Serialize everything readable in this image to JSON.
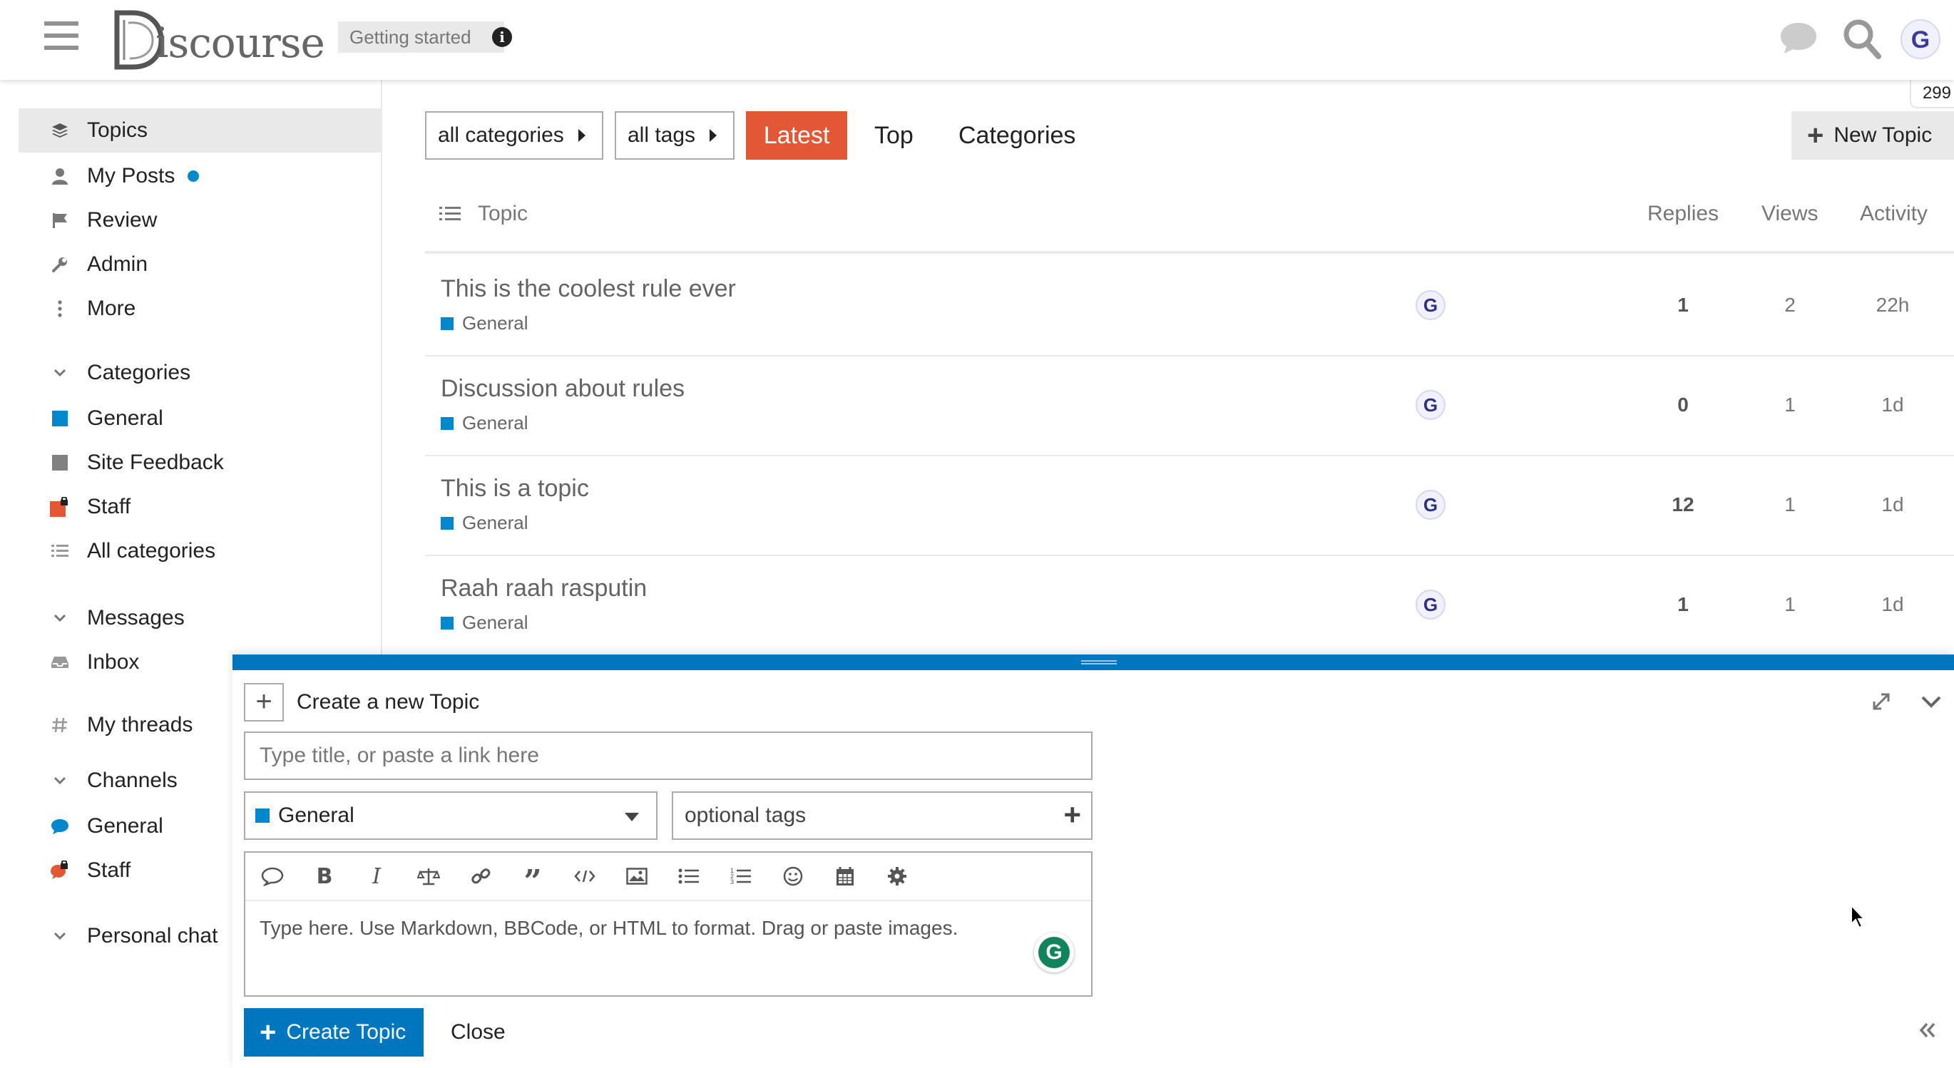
{
  "header": {
    "logo_text": "iscourse",
    "getting_started": "Getting started",
    "avatar_letter": "G",
    "notification_count": "299"
  },
  "sidebar": {
    "nav": [
      {
        "label": "Topics",
        "icon": "layers-icon"
      },
      {
        "label": "My Posts",
        "icon": "user-icon"
      },
      {
        "label": "Review",
        "icon": "flag-icon"
      },
      {
        "label": "Admin",
        "icon": "wrench-icon"
      },
      {
        "label": "More",
        "icon": "ellipsis-vertical-icon"
      }
    ],
    "categories_heading": "Categories",
    "categories": [
      {
        "label": "General",
        "color": "#0088cc"
      },
      {
        "label": "Site Feedback",
        "color": "#808281"
      },
      {
        "label": "Staff",
        "color": "#e45735"
      },
      {
        "label": "All categories",
        "icon": "list-icon"
      }
    ],
    "messages_heading": "Messages",
    "inbox": "Inbox",
    "my_threads": "My threads",
    "channels_heading": "Channels",
    "channels": [
      {
        "label": "General",
        "color": "#0088cc"
      },
      {
        "label": "Staff",
        "color": "#e45735"
      }
    ],
    "personal_chat_heading": "Personal chat"
  },
  "filters": {
    "categories": "all categories",
    "tags": "all tags",
    "latest": "Latest",
    "top": "Top",
    "categories_link": "Categories",
    "new_topic": "New Topic"
  },
  "topic_list": {
    "headers": {
      "topic": "Topic",
      "replies": "Replies",
      "views": "Views",
      "activity": "Activity"
    },
    "rows": [
      {
        "title": "This is the coolest rule ever",
        "category": "General",
        "poster": "G",
        "replies": "1",
        "views": "2",
        "activity": "22h"
      },
      {
        "title": "Discussion about rules",
        "category": "General",
        "poster": "G",
        "replies": "0",
        "views": "1",
        "activity": "1d"
      },
      {
        "title": "This is a topic",
        "category": "General",
        "poster": "G",
        "replies": "12",
        "views": "1",
        "activity": "1d"
      },
      {
        "title": "Raah raah rasputin",
        "category": "General",
        "poster": "G",
        "replies": "1",
        "views": "1",
        "activity": "1d"
      }
    ]
  },
  "composer": {
    "heading": "Create a new Topic",
    "title_placeholder": "Type title, or paste a link here",
    "category": "General",
    "tags_placeholder": "optional tags",
    "editor_placeholder": "Type here. Use Markdown, BBCode, or HTML to format. Drag or paste images.",
    "create_button": "Create Topic",
    "close": "Close",
    "grammarly_letter": "G",
    "toolbar": [
      "speech-bubble-icon",
      "bold-icon",
      "italic-icon",
      "scale-icon",
      "link-icon",
      "quote-icon",
      "code-icon",
      "image-icon",
      "bullet-list-icon",
      "numbered-list-icon",
      "emoji-icon",
      "calendar-icon",
      "gear-icon"
    ]
  },
  "colors": {
    "accent_latest": "#e45735",
    "primary_blue": "#0076bf",
    "category_general": "#0088cc"
  }
}
